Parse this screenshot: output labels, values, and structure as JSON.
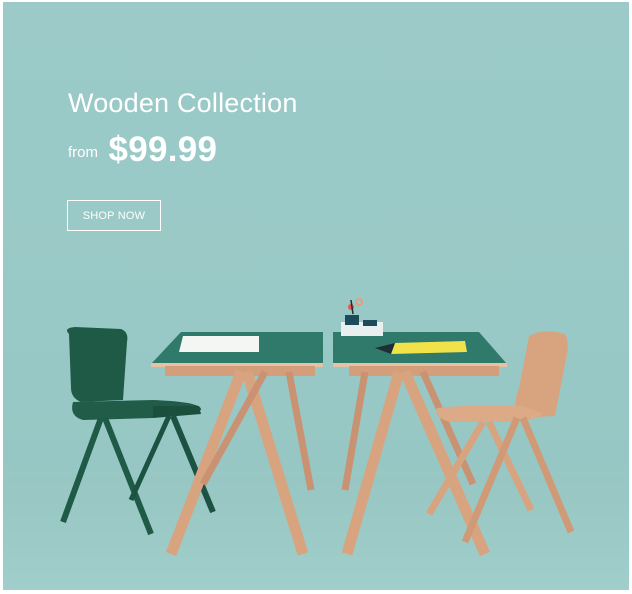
{
  "hero": {
    "title": "Wooden Collection",
    "price_prefix": "from",
    "price": "$99.99",
    "cta_label": "SHOP NOW"
  },
  "colors": {
    "background": "#9bcac8",
    "text": "#ffffff",
    "table_top": "#2f7a6a",
    "wood": "#d8a480",
    "chair_dark": "#1f5a47"
  },
  "scene_items": [
    "dark-green-chair",
    "left-table",
    "right-table",
    "desk-organizer",
    "notebook",
    "paper-sheet",
    "wooden-chair"
  ]
}
